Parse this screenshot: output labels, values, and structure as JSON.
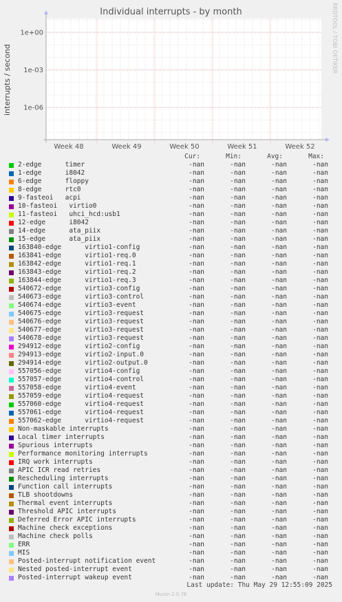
{
  "chart_data": {
    "type": "line",
    "title": "Individual interrupts - by month",
    "ylabel": "interrupts / second",
    "yscale": "log",
    "y_tick_labels": [
      "1e+00",
      "1e-03",
      "1e-06"
    ],
    "x_tick_labels": [
      "Week 48",
      "Week 49",
      "Week 50",
      "Week 51",
      "Week 52"
    ],
    "grid": true,
    "series_values": "all -nan (no data plotted)"
  },
  "side_label": "RRDTOOL / TOBI OETIKER",
  "legend": {
    "headers": [
      "Cur:",
      "Min:",
      "Avg:",
      "Max:"
    ],
    "rows": [
      {
        "label": "2-edge      timer",
        "color": "#00cc00",
        "cur": "-nan",
        "min": "-nan",
        "avg": "-nan",
        "max": "-nan"
      },
      {
        "label": "1-edge      i8042",
        "color": "#0066b3",
        "cur": "-nan",
        "min": "-nan",
        "avg": "-nan",
        "max": "-nan"
      },
      {
        "label": "6-edge      floppy",
        "color": "#ff8000",
        "cur": "-nan",
        "min": "-nan",
        "avg": "-nan",
        "max": "-nan"
      },
      {
        "label": "8-edge      rtc0",
        "color": "#ffcc00",
        "cur": "-nan",
        "min": "-nan",
        "avg": "-nan",
        "max": "-nan"
      },
      {
        "label": "9-fasteoi   acpi",
        "color": "#330099",
        "cur": "-nan",
        "min": "-nan",
        "avg": "-nan",
        "max": "-nan"
      },
      {
        "label": "10-fasteoi   virtio0",
        "color": "#990099",
        "cur": "-nan",
        "min": "-nan",
        "avg": "-nan",
        "max": "-nan"
      },
      {
        "label": "11-fasteoi   uhci_hcd:usb1",
        "color": "#ccff00",
        "cur": "-nan",
        "min": "-nan",
        "avg": "-nan",
        "max": "-nan"
      },
      {
        "label": "12-edge      i8042",
        "color": "#ff0000",
        "cur": "-nan",
        "min": "-nan",
        "avg": "-nan",
        "max": "-nan"
      },
      {
        "label": "14-edge      ata_piix",
        "color": "#808080",
        "cur": "-nan",
        "min": "-nan",
        "avg": "-nan",
        "max": "-nan"
      },
      {
        "label": "15-edge      ata_piix",
        "color": "#008f00",
        "cur": "-nan",
        "min": "-nan",
        "avg": "-nan",
        "max": "-nan"
      },
      {
        "label": "163840-edge      virtio1-config",
        "color": "#00487d",
        "cur": "-nan",
        "min": "-nan",
        "avg": "-nan",
        "max": "-nan"
      },
      {
        "label": "163841-edge      virtio1-req.0",
        "color": "#b35a00",
        "cur": "-nan",
        "min": "-nan",
        "avg": "-nan",
        "max": "-nan"
      },
      {
        "label": "163842-edge      virtio1-req.1",
        "color": "#b38f00",
        "cur": "-nan",
        "min": "-nan",
        "avg": "-nan",
        "max": "-nan"
      },
      {
        "label": "163843-edge      virtio1-req.2",
        "color": "#6b006b",
        "cur": "-nan",
        "min": "-nan",
        "avg": "-nan",
        "max": "-nan"
      },
      {
        "label": "163844-edge      virtio1-req.3",
        "color": "#8fb300",
        "cur": "-nan",
        "min": "-nan",
        "avg": "-nan",
        "max": "-nan"
      },
      {
        "label": "540672-edge      virtio3-config",
        "color": "#b30000",
        "cur": "-nan",
        "min": "-nan",
        "avg": "-nan",
        "max": "-nan"
      },
      {
        "label": "540673-edge      virtio3-control",
        "color": "#bebebe",
        "cur": "-nan",
        "min": "-nan",
        "avg": "-nan",
        "max": "-nan"
      },
      {
        "label": "540674-edge      virtio3-event",
        "color": "#80ff80",
        "cur": "-nan",
        "min": "-nan",
        "avg": "-nan",
        "max": "-nan"
      },
      {
        "label": "540675-edge      virtio3-request",
        "color": "#80c9ff",
        "cur": "-nan",
        "min": "-nan",
        "avg": "-nan",
        "max": "-nan"
      },
      {
        "label": "540676-edge      virtio3-request",
        "color": "#ffc080",
        "cur": "-nan",
        "min": "-nan",
        "avg": "-nan",
        "max": "-nan"
      },
      {
        "label": "540677-edge      virtio3-request",
        "color": "#ffe680",
        "cur": "-nan",
        "min": "-nan",
        "avg": "-nan",
        "max": "-nan"
      },
      {
        "label": "540678-edge      virtio3-request",
        "color": "#aa80ff",
        "cur": "-nan",
        "min": "-nan",
        "avg": "-nan",
        "max": "-nan"
      },
      {
        "label": "294912-edge      virtio2-config",
        "color": "#ee00cc",
        "cur": "-nan",
        "min": "-nan",
        "avg": "-nan",
        "max": "-nan"
      },
      {
        "label": "294913-edge      virtio2-input.0",
        "color": "#ff8080",
        "cur": "-nan",
        "min": "-nan",
        "avg": "-nan",
        "max": "-nan"
      },
      {
        "label": "294914-edge      virtio2-output.0",
        "color": "#666600",
        "cur": "-nan",
        "min": "-nan",
        "avg": "-nan",
        "max": "-nan"
      },
      {
        "label": "557056-edge      virtio4-config",
        "color": "#ffbfff",
        "cur": "-nan",
        "min": "-nan",
        "avg": "-nan",
        "max": "-nan"
      },
      {
        "label": "557057-edge      virtio4-control",
        "color": "#00ffcc",
        "cur": "-nan",
        "min": "-nan",
        "avg": "-nan",
        "max": "-nan"
      },
      {
        "label": "557058-edge      virtio4-event",
        "color": "#cc6699",
        "cur": "-nan",
        "min": "-nan",
        "avg": "-nan",
        "max": "-nan"
      },
      {
        "label": "557059-edge      virtio4-request",
        "color": "#999900",
        "cur": "-nan",
        "min": "-nan",
        "avg": "-nan",
        "max": "-nan"
      },
      {
        "label": "557060-edge      virtio4-request",
        "color": "#00cc00",
        "cur": "-nan",
        "min": "-nan",
        "avg": "-nan",
        "max": "-nan"
      },
      {
        "label": "557061-edge      virtio4-request",
        "color": "#0066b3",
        "cur": "-nan",
        "min": "-nan",
        "avg": "-nan",
        "max": "-nan"
      },
      {
        "label": "557062-edge      virtio4-request",
        "color": "#ff8000",
        "cur": "-nan",
        "min": "-nan",
        "avg": "-nan",
        "max": "-nan"
      },
      {
        "label": "Non-maskable interrupts",
        "color": "#ffcc00",
        "cur": "-nan",
        "min": "-nan",
        "avg": "-nan",
        "max": "-nan"
      },
      {
        "label": "Local timer interrupts",
        "color": "#330099",
        "cur": "-nan",
        "min": "-nan",
        "avg": "-nan",
        "max": "-nan"
      },
      {
        "label": "Spurious interrupts",
        "color": "#990099",
        "cur": "-nan",
        "min": "-nan",
        "avg": "-nan",
        "max": "-nan"
      },
      {
        "label": "Performance monitoring interrupts",
        "color": "#ccff00",
        "cur": "-nan",
        "min": "-nan",
        "avg": "-nan",
        "max": "-nan"
      },
      {
        "label": "IRQ work interrupts",
        "color": "#ff0000",
        "cur": "-nan",
        "min": "-nan",
        "avg": "-nan",
        "max": "-nan"
      },
      {
        "label": "APIC ICR read retries",
        "color": "#808080",
        "cur": "-nan",
        "min": "-nan",
        "avg": "-nan",
        "max": "-nan"
      },
      {
        "label": "Rescheduling interrupts",
        "color": "#008f00",
        "cur": "-nan",
        "min": "-nan",
        "avg": "-nan",
        "max": "-nan"
      },
      {
        "label": "Function call interrupts",
        "color": "#00487d",
        "cur": "-nan",
        "min": "-nan",
        "avg": "-nan",
        "max": "-nan"
      },
      {
        "label": "TLB shootdowns",
        "color": "#b35a00",
        "cur": "-nan",
        "min": "-nan",
        "avg": "-nan",
        "max": "-nan"
      },
      {
        "label": "Thermal event interrupts",
        "color": "#b38f00",
        "cur": "-nan",
        "min": "-nan",
        "avg": "-nan",
        "max": "-nan"
      },
      {
        "label": "Threshold APIC interrupts",
        "color": "#6b006b",
        "cur": "-nan",
        "min": "-nan",
        "avg": "-nan",
        "max": "-nan"
      },
      {
        "label": "Deferred Error APIC interrupts",
        "color": "#8fb300",
        "cur": "-nan",
        "min": "-nan",
        "avg": "-nan",
        "max": "-nan"
      },
      {
        "label": "Machine check exceptions",
        "color": "#b30000",
        "cur": "-nan",
        "min": "-nan",
        "avg": "-nan",
        "max": "-nan"
      },
      {
        "label": "Machine check polls",
        "color": "#bebebe",
        "cur": "-nan",
        "min": "-nan",
        "avg": "-nan",
        "max": "-nan"
      },
      {
        "label": "ERR",
        "color": "#80ff80",
        "cur": "-nan",
        "min": "-nan",
        "avg": "-nan",
        "max": "-nan"
      },
      {
        "label": "MIS",
        "color": "#80c9ff",
        "cur": "-nan",
        "min": "-nan",
        "avg": "-nan",
        "max": "-nan"
      },
      {
        "label": "Posted-interrupt notification event",
        "color": "#ffc080",
        "cur": "-nan",
        "min": "-nan",
        "avg": "-nan",
        "max": "-nan"
      },
      {
        "label": "Nested posted-interrupt event",
        "color": "#ffe680",
        "cur": "-nan",
        "min": "-nan",
        "avg": "-nan",
        "max": "-nan"
      },
      {
        "label": "Posted-interrupt wakeup event",
        "color": "#aa80ff",
        "cur": "-nan",
        "min": "-nan",
        "avg": "-nan",
        "max": "-nan"
      }
    ]
  },
  "footer": {
    "last_update": "Last update: Thu May 29 12:55:09 2025",
    "generator": "Munin 2.0.76"
  }
}
